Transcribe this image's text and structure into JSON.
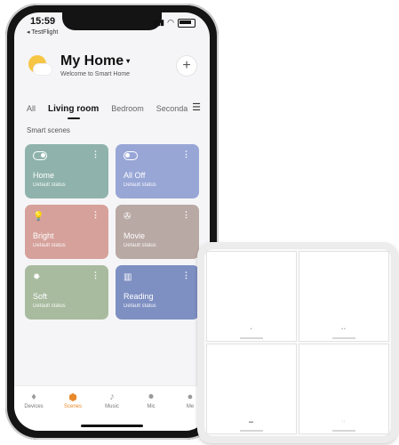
{
  "status_bar": {
    "time": "15:59",
    "back_app": "◂ TestFlight",
    "signal": "▮▮▮",
    "wifi": "◠"
  },
  "header": {
    "title": "My Home",
    "title_caret": "▾",
    "subtitle": "Welcome to Smart Home",
    "add_label": "+"
  },
  "tabs": [
    {
      "label": "All",
      "active": false
    },
    {
      "label": "Living room",
      "active": true
    },
    {
      "label": "Bedroom",
      "active": false
    },
    {
      "label": "Seconda",
      "active": false
    }
  ],
  "menu_icon": "☰",
  "section_label": "Smart scenes",
  "scenes": [
    {
      "name": "Home",
      "status": "Default status",
      "icon": "toggle-on-icon",
      "color": "#8fb3ac"
    },
    {
      "name": "All Off",
      "status": "Default status",
      "icon": "toggle-off-icon",
      "color": "#98a6d6"
    },
    {
      "name": "Bright",
      "status": "Default status",
      "icon": "lightbulb-icon",
      "glyph": "💡",
      "color": "#d6a19b"
    },
    {
      "name": "Movie",
      "status": "Default status",
      "icon": "film-reel-icon",
      "glyph": "✇",
      "color": "#b9a9a4"
    },
    {
      "name": "Soft",
      "status": "Default status",
      "icon": "sun-icon",
      "glyph": "✹",
      "color": "#a8bb9f"
    },
    {
      "name": "Reading",
      "status": "Default status",
      "icon": "books-icon",
      "glyph": "▥",
      "color": "#7e8fc2"
    }
  ],
  "card_more": "⋮",
  "bottom_nav": [
    {
      "label": "Devices",
      "icon": "bulb-icon",
      "glyph": "♦",
      "active": false
    },
    {
      "label": "Scenes",
      "icon": "cube-icon",
      "glyph": "⬢",
      "active": true
    },
    {
      "label": "Music",
      "icon": "music-note-icon",
      "glyph": "♪",
      "active": false
    },
    {
      "label": "Mic",
      "icon": "microphone-icon",
      "glyph": "⏺",
      "active": false
    },
    {
      "label": "Me",
      "icon": "person-icon",
      "glyph": "●",
      "active": false
    }
  ],
  "colors": {
    "accent": "#e8892c"
  }
}
